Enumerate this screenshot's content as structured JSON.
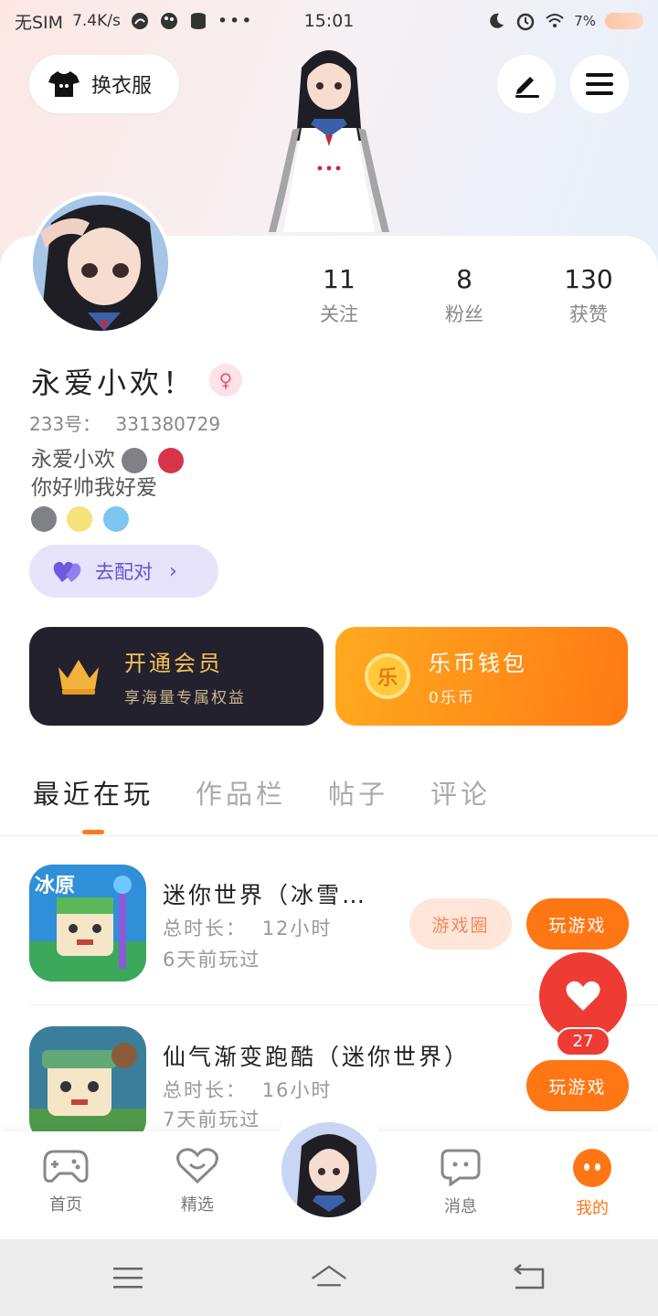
{
  "status_bar": {
    "carrier": "无SIM",
    "speed": "7.4K/s",
    "time": "15:01",
    "battery": "7%"
  },
  "header": {
    "outfit_label": "换衣服"
  },
  "profile": {
    "following_count": "11",
    "following_label": "关注",
    "fans_count": "8",
    "fans_label": "粉丝",
    "likes_count": "130",
    "likes_label": "获赞",
    "nickname": "永爱小欢！",
    "gender_symbol": "♀",
    "uid_label": "233号：",
    "uid_value": "331380729",
    "bio_line1": "永爱小欢",
    "bio_line2": "你好帅我好爱",
    "match_label": "去配对"
  },
  "promos": {
    "vip_title": "开通会员",
    "vip_sub": "享海量专属权益",
    "wallet_icon_text": "乐",
    "wallet_title": "乐币钱包",
    "wallet_sub": "0乐币"
  },
  "tabs": [
    "最近在玩",
    "作品栏",
    "帖子",
    "评论"
  ],
  "games": [
    {
      "name": "迷你世界（冰雪…",
      "icon_text": "冰原",
      "duration_label": "总时长：",
      "duration_value": "12小时",
      "last_played": "6天前玩过",
      "circle_label": "游戏圈",
      "play_label": "玩游戏"
    },
    {
      "name": "仙气渐变跑酷（迷你世界）",
      "duration_label": "总时长：",
      "duration_value": "16小时",
      "last_played": "7天前玩过",
      "play_label": "玩游戏"
    }
  ],
  "like_float": {
    "count": "27"
  },
  "bottom_nav": {
    "home": "首页",
    "featured": "精选",
    "messages": "消息",
    "mine": "我的"
  },
  "colors": {
    "accent": "#ff7614",
    "like_red": "#ee3b34",
    "match_purple": "#6653cf",
    "vip_bg": "#24212e",
    "vip_gold": "#f3c35c"
  }
}
